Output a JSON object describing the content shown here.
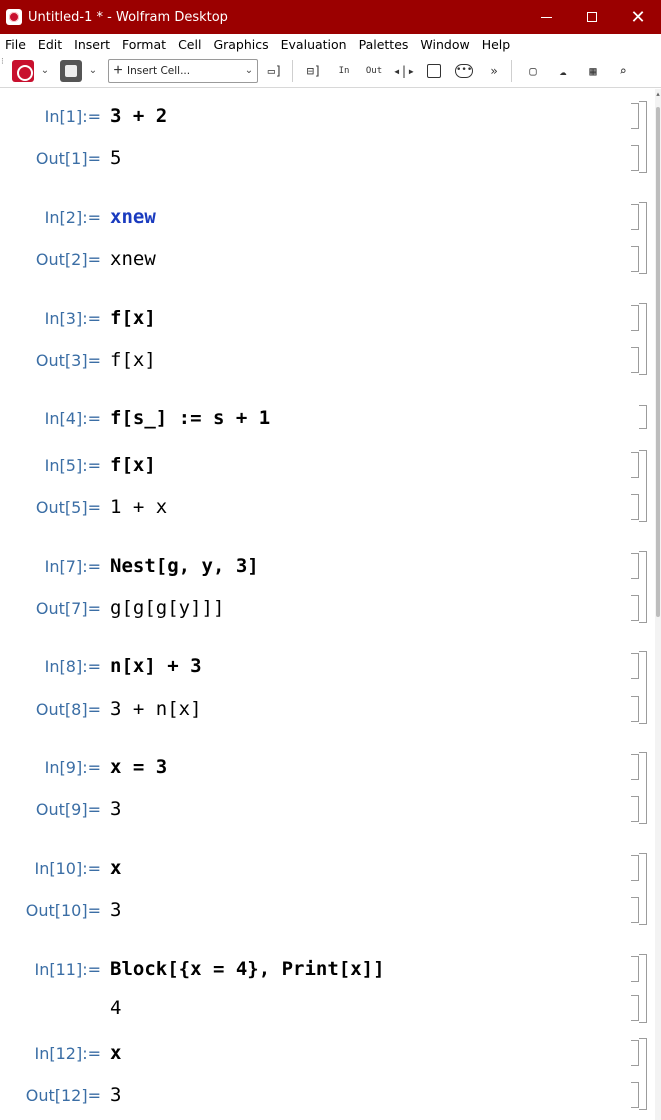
{
  "window": {
    "title": "Untitled-1 * - Wolfram Desktop",
    "minimize": "—",
    "maximize": "☐",
    "close": "✕"
  },
  "menu": [
    "File",
    "Edit",
    "Insert",
    "Format",
    "Cell",
    "Graphics",
    "Evaluation",
    "Palettes",
    "Window",
    "Help"
  ],
  "toolbar": {
    "insert_cell_label": "Insert Cell...",
    "in_label": "In",
    "out_label": "Out"
  },
  "cells": [
    {
      "in_label": "In[1]:=",
      "input": "3 + 2",
      "out_label": "Out[1]=",
      "output": "5"
    },
    {
      "in_label": "In[2]:=",
      "input": "xnew",
      "out_label": "Out[2]=",
      "output": "xnew"
    },
    {
      "in_label": "In[3]:=",
      "input": "f[x]",
      "out_label": "Out[3]=",
      "output": "f[x]"
    },
    {
      "in_label": "In[4]:=",
      "input": "f[s_] := s + 1"
    },
    {
      "in_label": "In[5]:=",
      "input": "f[x]",
      "out_label": "Out[5]=",
      "output": "1 + x"
    },
    {
      "in_label": "In[7]:=",
      "input": "Nest[g, y, 3]",
      "out_label": "Out[7]=",
      "output": "g[g[g[y]]]"
    },
    {
      "in_label": "In[8]:=",
      "input": "n[x] + 3",
      "out_label": "Out[8]=",
      "output": "3 + n[x]"
    },
    {
      "in_label": "In[9]:=",
      "input": "x = 3",
      "out_label": "Out[9]=",
      "output": "3"
    },
    {
      "in_label": "In[10]:=",
      "input": "x",
      "out_label": "Out[10]=",
      "output": "3"
    },
    {
      "in_label": "In[11]:=",
      "input": "Block[{x = 4}, Print[x]]",
      "print": "4"
    },
    {
      "in_label": "In[12]:=",
      "input": "x",
      "out_label": "Out[12]=",
      "output": "3"
    }
  ]
}
